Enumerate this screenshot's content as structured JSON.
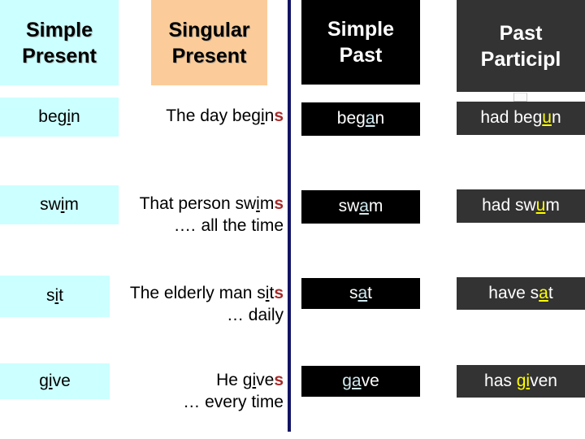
{
  "table": {
    "headers": [
      {
        "line1": "Simple",
        "line2": "Present",
        "style": "cyan"
      },
      {
        "line1": "Singular",
        "line2": "Present",
        "style": "orange"
      },
      {
        "line1": "Simple",
        "line2": "Past",
        "style": "black"
      },
      {
        "line1": "Past",
        "line2": "Participl",
        "style": "gray"
      }
    ],
    "rows": [
      {
        "base": {
          "pre": "be",
          "mid": "gi",
          "post": "n"
        },
        "sentence": {
          "pre": "The day be",
          "mid": "gi",
          "post": "n",
          "suffix": "s",
          "second_line": ""
        },
        "past": {
          "pre": "beg",
          "mid": "a",
          "post": "n"
        },
        "participle": {
          "pre": "had beg",
          "mid": "u",
          "post": "n"
        }
      },
      {
        "base": {
          "pre": "sw",
          "mid": "i",
          "post": "m"
        },
        "sentence": {
          "pre": "That person sw",
          "mid": "i",
          "post": "m",
          "suffix": "s",
          "second_line": ".… all the time"
        },
        "past": {
          "pre": "sw",
          "mid": "a",
          "post": "m"
        },
        "participle": {
          "pre": "had sw",
          "mid": "u",
          "post": "m"
        }
      },
      {
        "base": {
          "pre": "s",
          "mid": "i",
          "post": "t"
        },
        "sentence": {
          "pre": "The elderly man s",
          "mid": "i",
          "post": "t",
          "suffix": "s",
          "second_line": "… daily"
        },
        "past": {
          "pre": "s",
          "mid": "a",
          "post": "t"
        },
        "participle": {
          "pre": "have s",
          "mid": "a",
          "post": "t"
        }
      },
      {
        "base": {
          "pre": "",
          "mid": "gi",
          "post": "ve"
        },
        "sentence": {
          "pre": "He ",
          "mid": "gi",
          "post": "ve",
          "suffix": "s",
          "second_line": "… every time"
        },
        "past": {
          "pre": "",
          "mid": "ga",
          "post": "ve"
        },
        "participle": {
          "pre": "has ",
          "mid": "gi",
          "post": "ven"
        }
      }
    ]
  },
  "colors": {
    "header_cyan": "#ccffff",
    "header_orange": "#fbcc99",
    "header_black": "#000000",
    "header_gray": "#333333",
    "divider_navy": "#131364",
    "emphasis_red": "#a62a2a",
    "emphasis_cyan": "#cfe9ef",
    "emphasis_yellow": "#ffff00"
  }
}
